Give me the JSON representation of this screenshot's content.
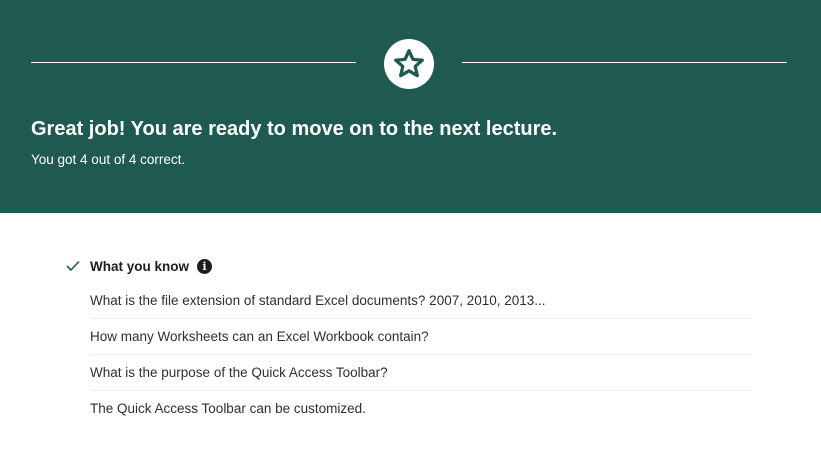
{
  "banner": {
    "headline": "Great job! You are ready to move on to the next lecture.",
    "score_text": "You got 4 out of 4 correct.",
    "badge_icon": "star-icon",
    "background_color": "#1e5a4f"
  },
  "knowledge": {
    "title": "What you know",
    "status_icon": "check-icon",
    "help_icon": "info-icon",
    "help_glyph": "i",
    "accent_color": "#1e5a4f",
    "questions": [
      "What is the file extension of standard Excel documents? 2007, 2010, 2013...",
      "How many Worksheets can an Excel Workbook contain?",
      "What is the purpose of the Quick Access Toolbar?",
      "The Quick Access Toolbar can be customized."
    ]
  }
}
